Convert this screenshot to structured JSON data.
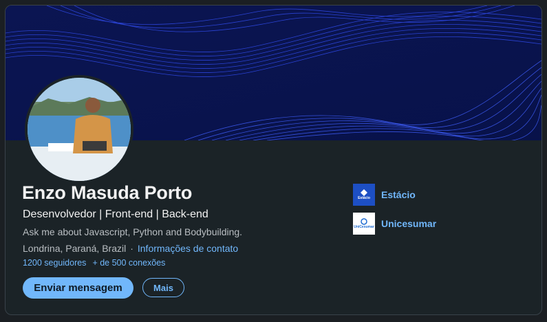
{
  "profile": {
    "name": "Enzo Masuda Porto",
    "headline": "Desenvolvedor | Front-end | Back-end",
    "about": "Ask me about Javascript, Python and Bodybuilding.",
    "location": "Londrina, Paraná, Brazil",
    "separator": "·",
    "contact_link": "Informações de contato",
    "followers": "1200 seguidores",
    "connections": "+ de 500 conexões"
  },
  "actions": {
    "primary_label": "Enviar mensagem",
    "secondary_label": "Mais"
  },
  "education": [
    {
      "name": "Estácio",
      "logo_text": "Estácio",
      "logo_icon": "estacio-logo-icon"
    },
    {
      "name": "Unicesumar",
      "logo_text": "UniCesumar",
      "logo_icon": "unicesumar-logo-icon"
    }
  ],
  "colors": {
    "accent": "#71b7fb",
    "card_bg": "#1b2327",
    "banner_bg": "#0a1550",
    "banner_lines": "#2f4dff"
  }
}
